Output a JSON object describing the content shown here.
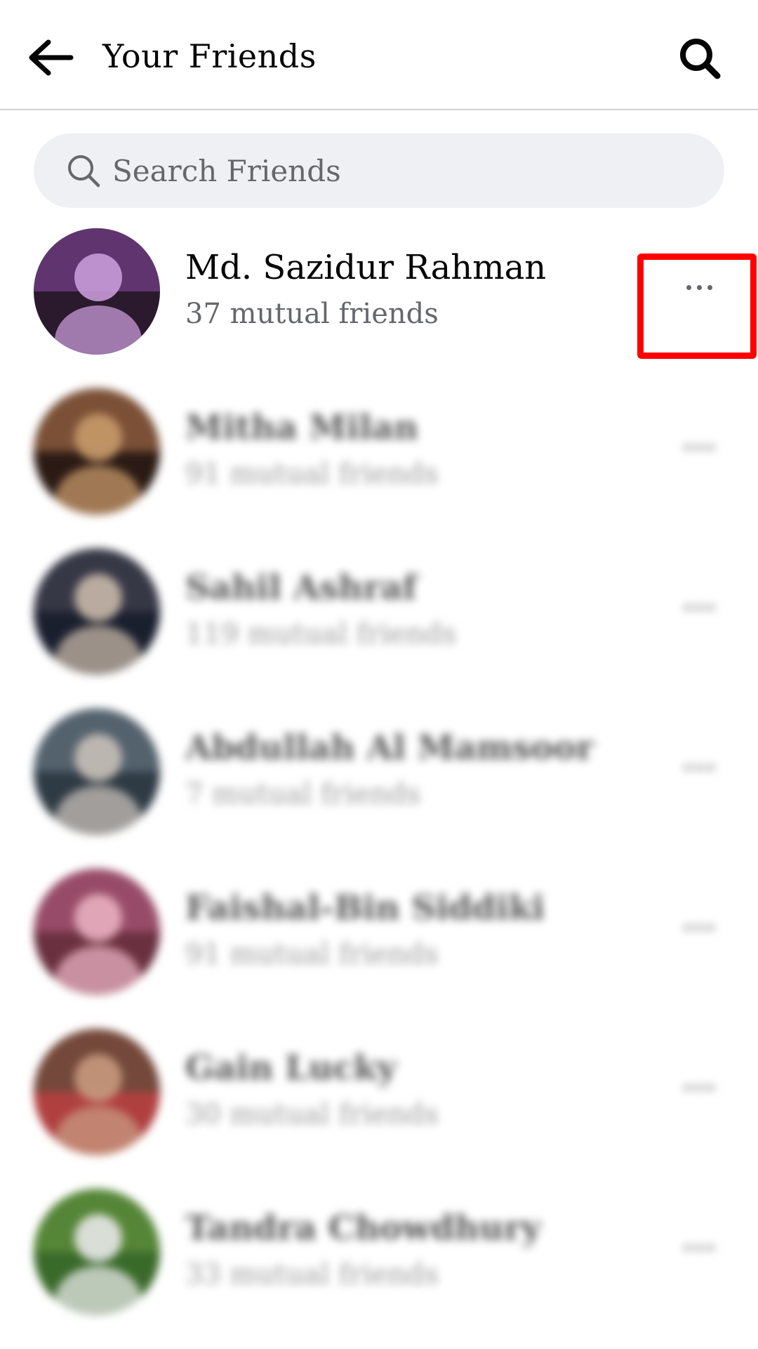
{
  "header": {
    "title": "Your Friends",
    "back_icon": "arrow-left-icon",
    "search_icon": "search-icon"
  },
  "search": {
    "placeholder": "Search Friends",
    "icon": "search-icon"
  },
  "friends": [
    {
      "name": "Md. Sazidur Rahman",
      "mutual": "37 mutual friends",
      "blurred": false,
      "avatar_colors": [
        "#6a3b7a",
        "#c89ad8",
        "#2b1a2e"
      ]
    },
    {
      "name": "Mitha Milan",
      "mutual": "91 mutual friends",
      "blurred": true,
      "avatar_colors": [
        "#8a5a3c",
        "#c89a6a",
        "#2b1a14"
      ]
    },
    {
      "name": "Sahil Ashraf",
      "mutual": "119 mutual friends",
      "blurred": true,
      "avatar_colors": [
        "#3d3d4a",
        "#c8b8a8",
        "#1a1f2e"
      ]
    },
    {
      "name": "Abdullah Al Mamsoor",
      "mutual": "7 mutual friends",
      "blurred": true,
      "avatar_colors": [
        "#5a6a74",
        "#c8c0b8",
        "#2e3a44"
      ]
    },
    {
      "name": "Faishal-Bin Siddiki",
      "mutual": "91 mutual friends",
      "blurred": true,
      "avatar_colors": [
        "#a05070",
        "#e8b0c0",
        "#6a3040"
      ]
    },
    {
      "name": "Gain Lucky",
      "mutual": "30 mutual friends",
      "blurred": true,
      "avatar_colors": [
        "#6a4a3a",
        "#c89a80",
        "#b04040"
      ]
    },
    {
      "name": "Tandra Chowdhury",
      "mutual": "33 mutual friends",
      "blurred": true,
      "avatar_colors": [
        "#5a8a3a",
        "#e8e8e8",
        "#3a6a2a"
      ]
    }
  ],
  "highlight": {
    "color": "#ff0000",
    "target": "more-options-button"
  }
}
